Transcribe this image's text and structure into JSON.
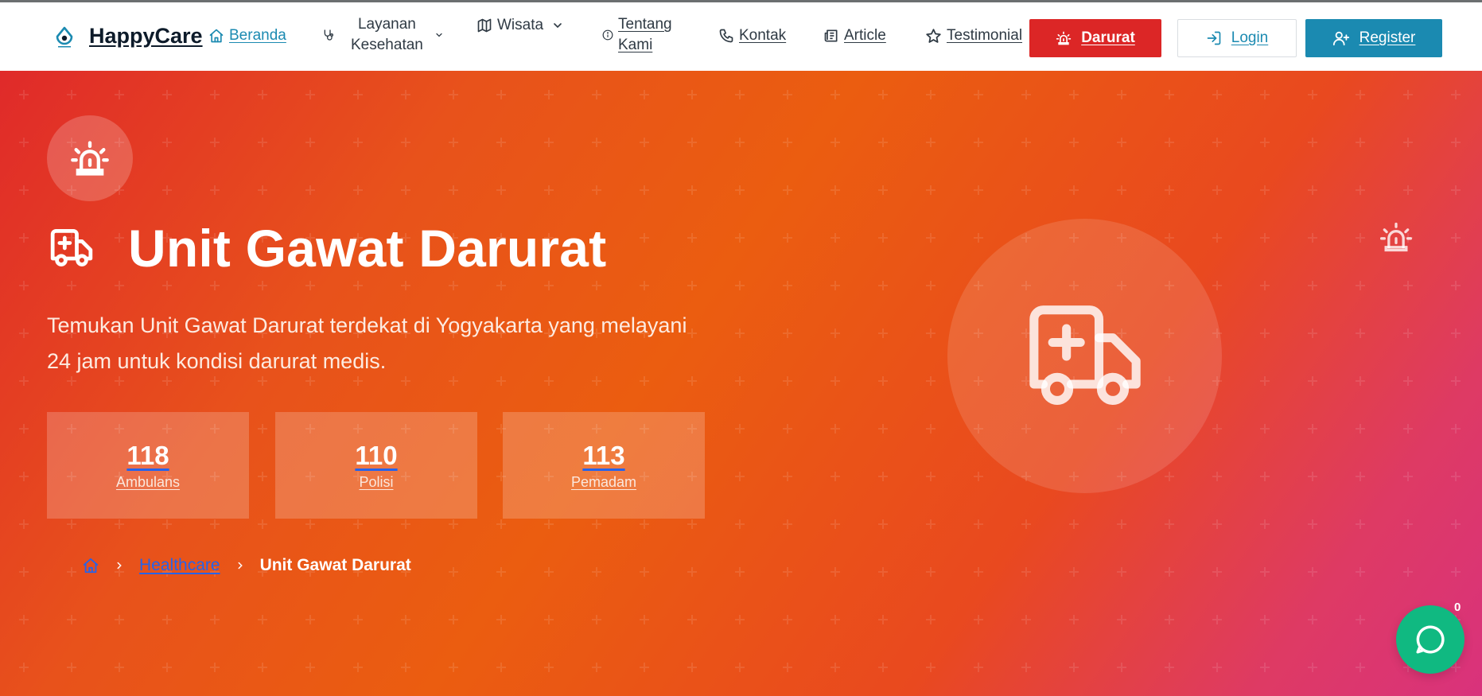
{
  "brand": {
    "name": "HappyCare",
    "logo_icon": "drop-logo-icon"
  },
  "nav": {
    "beranda": "Beranda",
    "layanan_line1": "Layanan",
    "layanan_line2": "Kesehatan",
    "wisata": "Wisata",
    "tentang_line1": "Tentang",
    "tentang_line2": "Kami",
    "kontak": "Kontak",
    "article": "Article",
    "testimonial": "Testimonial"
  },
  "buttons": {
    "darurat": "Darurat",
    "login": "Login",
    "register": "Register"
  },
  "hero": {
    "title": "Unit Gawat Darurat",
    "subtitle": "Temukan Unit Gawat Darurat terdekat di Yogyakarta yang melayani 24 jam untuk kondisi darurat medis.",
    "stats": [
      {
        "number": "118",
        "label": "Ambulans"
      },
      {
        "number": "110",
        "label": "Polisi"
      },
      {
        "number": "113",
        "label": "Pemadam"
      }
    ]
  },
  "breadcrumb": {
    "link": "Healthcare",
    "current": "Unit Gawat Darurat"
  },
  "chat": {
    "badge": "0"
  },
  "colors": {
    "accent": "#1b8ab1",
    "danger": "#dc2626",
    "chat": "#10b981"
  }
}
